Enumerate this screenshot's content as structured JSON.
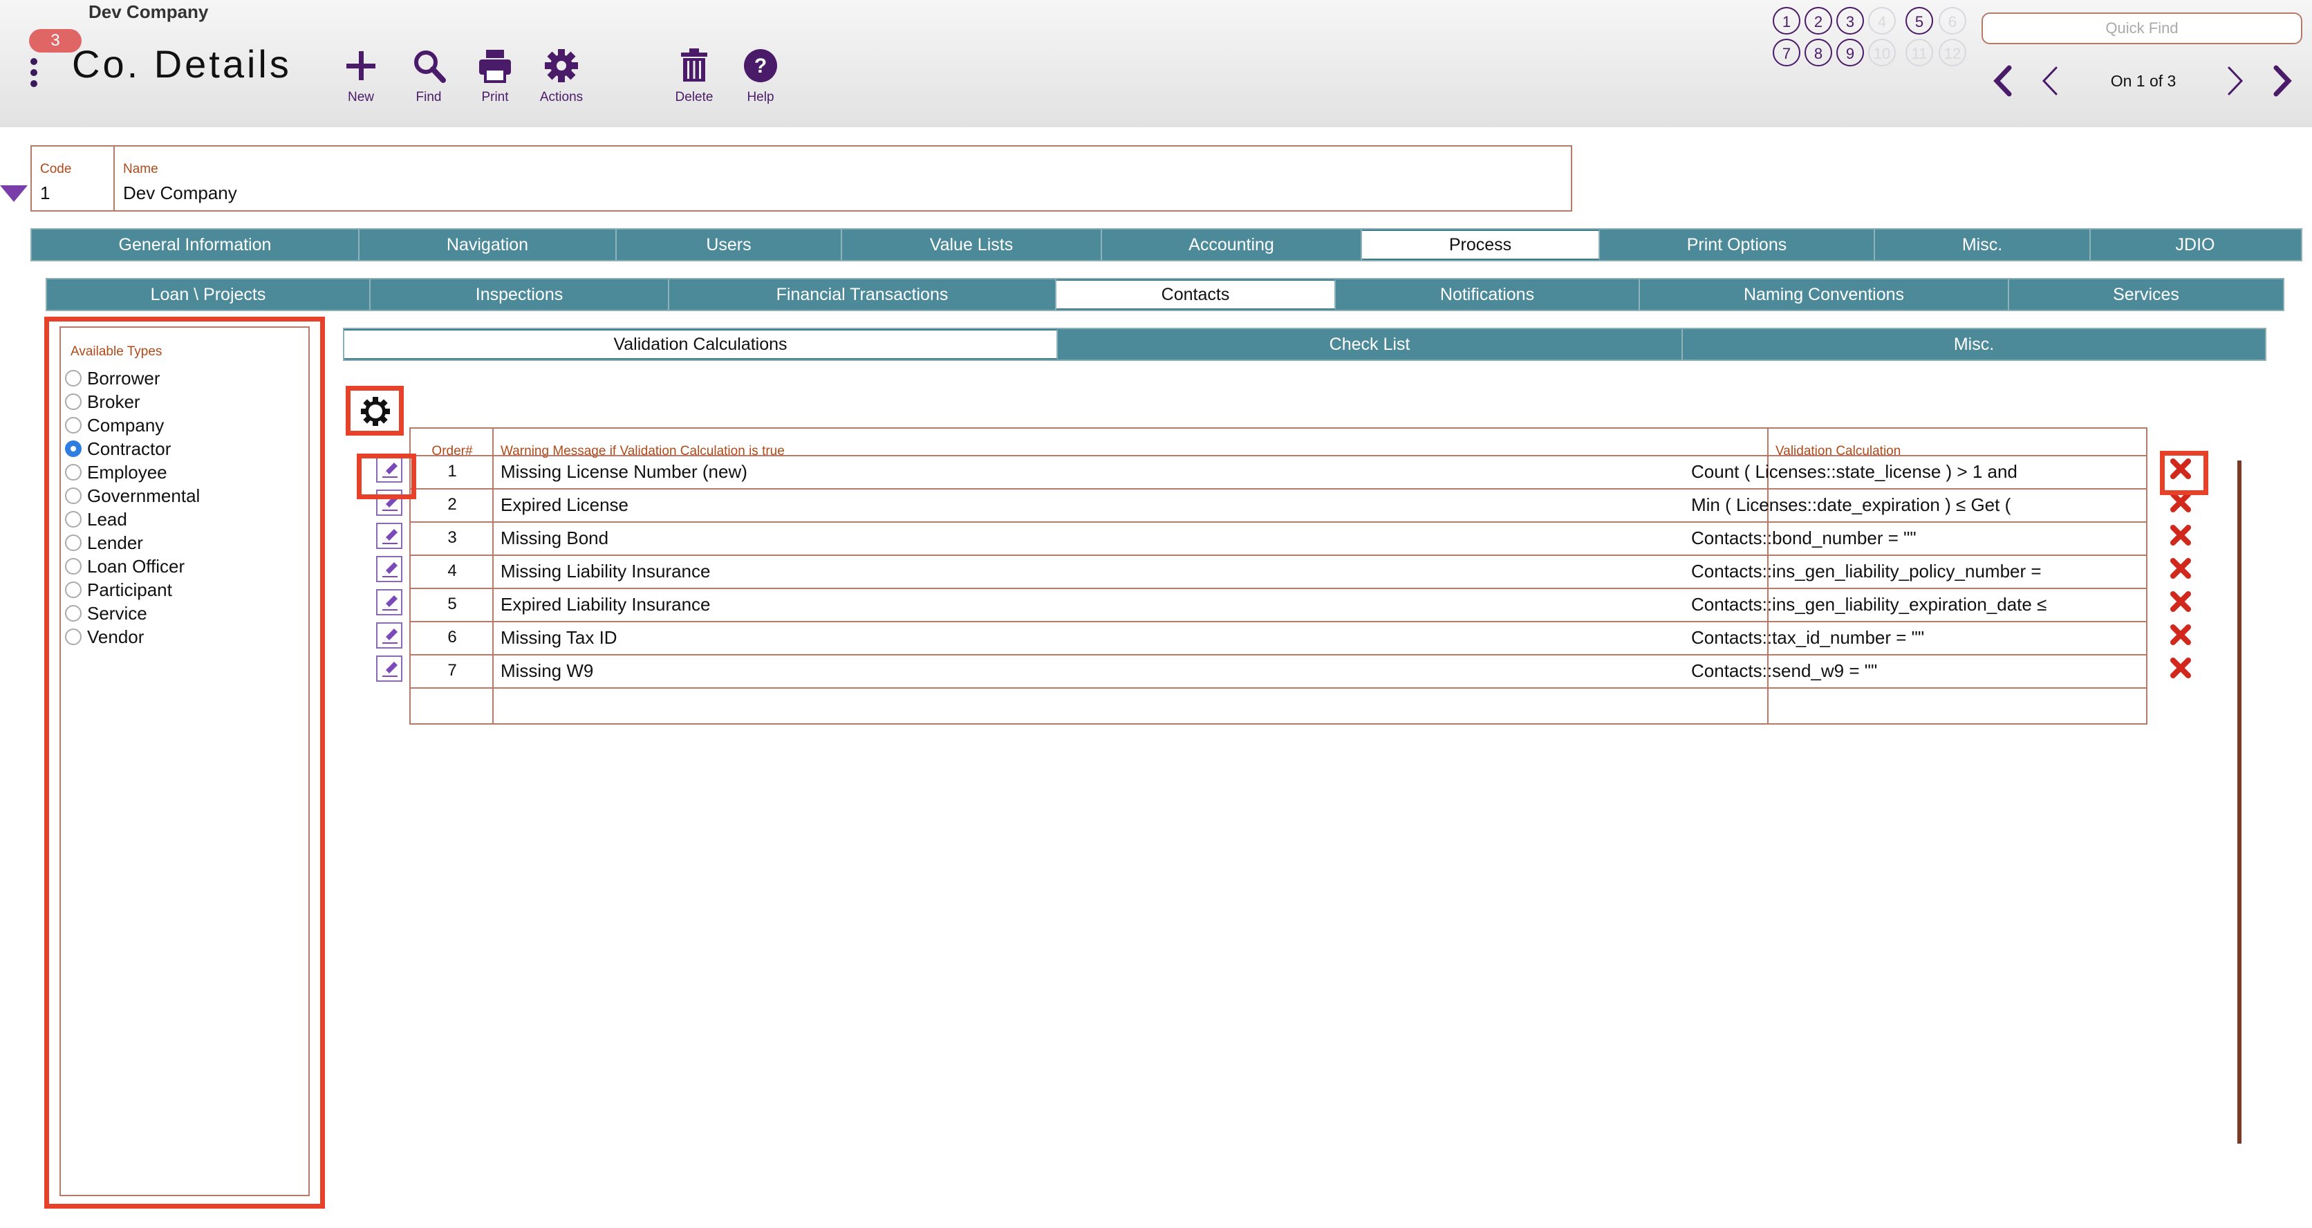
{
  "header": {
    "company_name": "Dev Company",
    "badge_count": "3",
    "layout_title": "Co. Details",
    "toolbar": {
      "new_label": "New",
      "find_label": "Find",
      "print_label": "Print",
      "actions_label": "Actions",
      "delete_label": "Delete",
      "help_label": "Help"
    },
    "quick_find_placeholder": "Quick Find",
    "record_status": "On 1 of 3",
    "numbered_buttons": [
      "1",
      "2",
      "3",
      "4",
      "5",
      "6",
      "7",
      "8",
      "9",
      "10",
      "11",
      "12"
    ],
    "enabled_numbers": [
      "1",
      "2",
      "3",
      "5",
      "7",
      "8",
      "9"
    ]
  },
  "record": {
    "code_label": "Code",
    "code_value": "1",
    "name_label": "Name",
    "name_value": "Dev Company"
  },
  "tabs_main": {
    "items": [
      "General Information",
      "Navigation",
      "Users",
      "Value Lists",
      "Accounting",
      "Process",
      "Print Options",
      "Misc.",
      "JDIO"
    ],
    "active": "Process"
  },
  "tabs_process": {
    "items": [
      "Loan \\ Projects",
      "Inspections",
      "Financial Transactions",
      "Contacts",
      "Notifications",
      "Naming Conventions",
      "Services"
    ],
    "active": "Contacts"
  },
  "tabs_contacts": {
    "items": [
      "Validation Calculations",
      "Check List",
      "Misc."
    ],
    "active": "Validation Calculations"
  },
  "available_types": {
    "label": "Available Types",
    "items": [
      "Borrower",
      "Broker",
      "Company",
      "Contractor",
      "Employee",
      "Governmental",
      "Lead",
      "Lender",
      "Loan Officer",
      "Participant",
      "Service",
      "Vendor"
    ],
    "selected": "Contractor"
  },
  "table": {
    "col_order": "Order#",
    "col_message": "Warning Message if Validation Calculation is true",
    "col_calc": "Validation Calculation",
    "rows": [
      {
        "order": "1",
        "message": "Missing License Number (new)",
        "calc": "Count ( Licenses::state_license ) > 1 and"
      },
      {
        "order": "2",
        "message": "Expired License",
        "calc": "Min ( Licenses::date_expiration ) ≤ Get ("
      },
      {
        "order": "3",
        "message": "Missing Bond",
        "calc": "Contacts::bond_number = \"\""
      },
      {
        "order": "4",
        "message": "Missing Liability Insurance",
        "calc": "Contacts::ins_gen_liability_policy_number ="
      },
      {
        "order": "5",
        "message": "Expired Liability Insurance",
        "calc": "Contacts::ins_gen_liability_expiration_date ≤"
      },
      {
        "order": "6",
        "message": "Missing Tax ID",
        "calc": "Contacts::tax_id_number = \"\""
      },
      {
        "order": "7",
        "message": "Missing W9",
        "calc": "Contacts::send_w9 = \"\""
      }
    ]
  },
  "colors": {
    "accent_purple": "#4a1b68",
    "tab_teal": "#4d8a99",
    "field_border": "#b77a6a",
    "label_brown": "#b04a1a",
    "highlight_red": "#e8412a",
    "delete_red": "#d0281c"
  },
  "icons": {
    "new": "plus-icon",
    "find": "magnifier-icon",
    "print": "printer-icon",
    "actions": "gear-icon",
    "delete": "trash-icon",
    "help": "question-icon",
    "edit": "pencil-icon",
    "remove": "x-icon"
  }
}
